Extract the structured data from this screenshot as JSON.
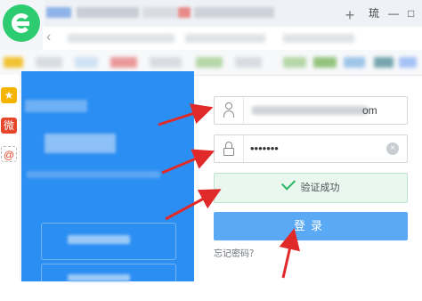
{
  "browser": {
    "new_tab_label": "+",
    "window_icon": "琉",
    "minimize_label": "—",
    "maximize_label": "□",
    "back_label": "‹"
  },
  "sidepanel": {
    "icons": [
      "star-icon",
      "weibo-icon",
      "mail-icon"
    ],
    "labels": [
      "★",
      "微",
      "@"
    ]
  },
  "login": {
    "username_suffix": "om",
    "password_mask": "•••••••",
    "clear_label": "×",
    "verify_text": "验证成功",
    "login_label": "登录",
    "forgot_label": "忘记密码？"
  },
  "colors": {
    "accent_blue": "#2b8ef2",
    "login_button": "#5aa9f4",
    "success_green": "#28b463",
    "annotation_red": "#e02a2a"
  }
}
